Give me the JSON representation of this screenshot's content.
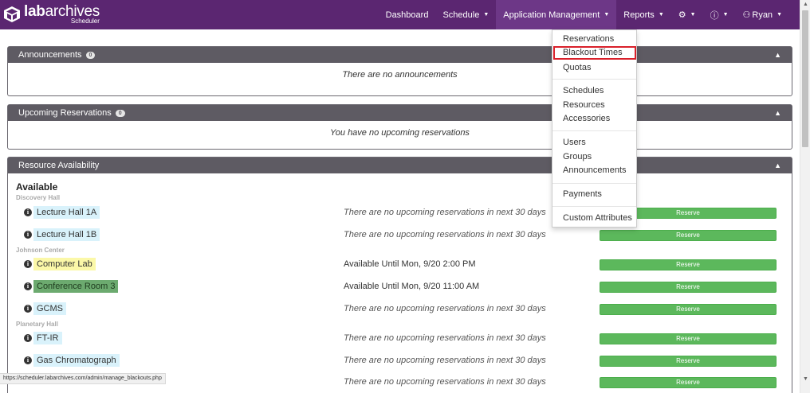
{
  "brand": {
    "name_bold": "lab",
    "name_rest": "archives",
    "sub": "Scheduler"
  },
  "nav": {
    "dashboard": "Dashboard",
    "schedule": "Schedule",
    "app_management": "Application Management",
    "reports": "Reports",
    "user": "Ryan"
  },
  "dropdown": {
    "items": [
      "Reservations",
      "Blackout Times",
      "Quotas",
      "Schedules",
      "Resources",
      "Accessories",
      "Users",
      "Groups",
      "Announcements",
      "Payments",
      "Custom Attributes"
    ],
    "highlighted_index": 1
  },
  "announcements": {
    "title": "Announcements",
    "count": "0",
    "empty": "There are no announcements"
  },
  "upcoming": {
    "title": "Upcoming Reservations",
    "count": "0",
    "empty": "You have no upcoming reservations"
  },
  "availability": {
    "title": "Resource Availability",
    "available_heading": "Available",
    "reserve_label": "Reserve",
    "groups": [
      "Discovery Hall",
      "Johnson Center",
      "Planetary Hall"
    ],
    "resources": [
      {
        "name": "Lecture Hall 1A",
        "status": "There are no upcoming reservations in next 30 days",
        "color": "#d9f2fb"
      },
      {
        "name": "Lecture Hall 1B",
        "status": "There are no upcoming reservations in next 30 days",
        "color": "#d9f2fb"
      },
      {
        "name": "Computer Lab",
        "status": "Available Until Mon, 9/20 2:00 PM",
        "color": "#fbf8a8"
      },
      {
        "name": "Conference Room 3",
        "status": "Available Until Mon, 9/20 11:00 AM",
        "color": "#6caa6f"
      },
      {
        "name": "GCMS",
        "status": "There are no upcoming reservations in next 30 days",
        "color": "#d9f2fb"
      },
      {
        "name": "FT-IR",
        "status": "There are no upcoming reservations in next 30 days",
        "color": "#d9f2fb"
      },
      {
        "name": "Gas Chromatograph",
        "status": "There are no upcoming reservations in next 30 days",
        "color": "#d9f2fb"
      },
      {
        "name": "",
        "status": "There are no upcoming reservations in next 30 days",
        "color": "#d9f2fb"
      }
    ]
  },
  "statusbar": {
    "url": "https://scheduler.labarchives.com/admin/manage_blackouts.php"
  },
  "colors": {
    "navbar": "#5b2671",
    "panel_header": "#5e5b63",
    "reserve": "#5cb85c",
    "highlight_border": "#d9202a"
  }
}
